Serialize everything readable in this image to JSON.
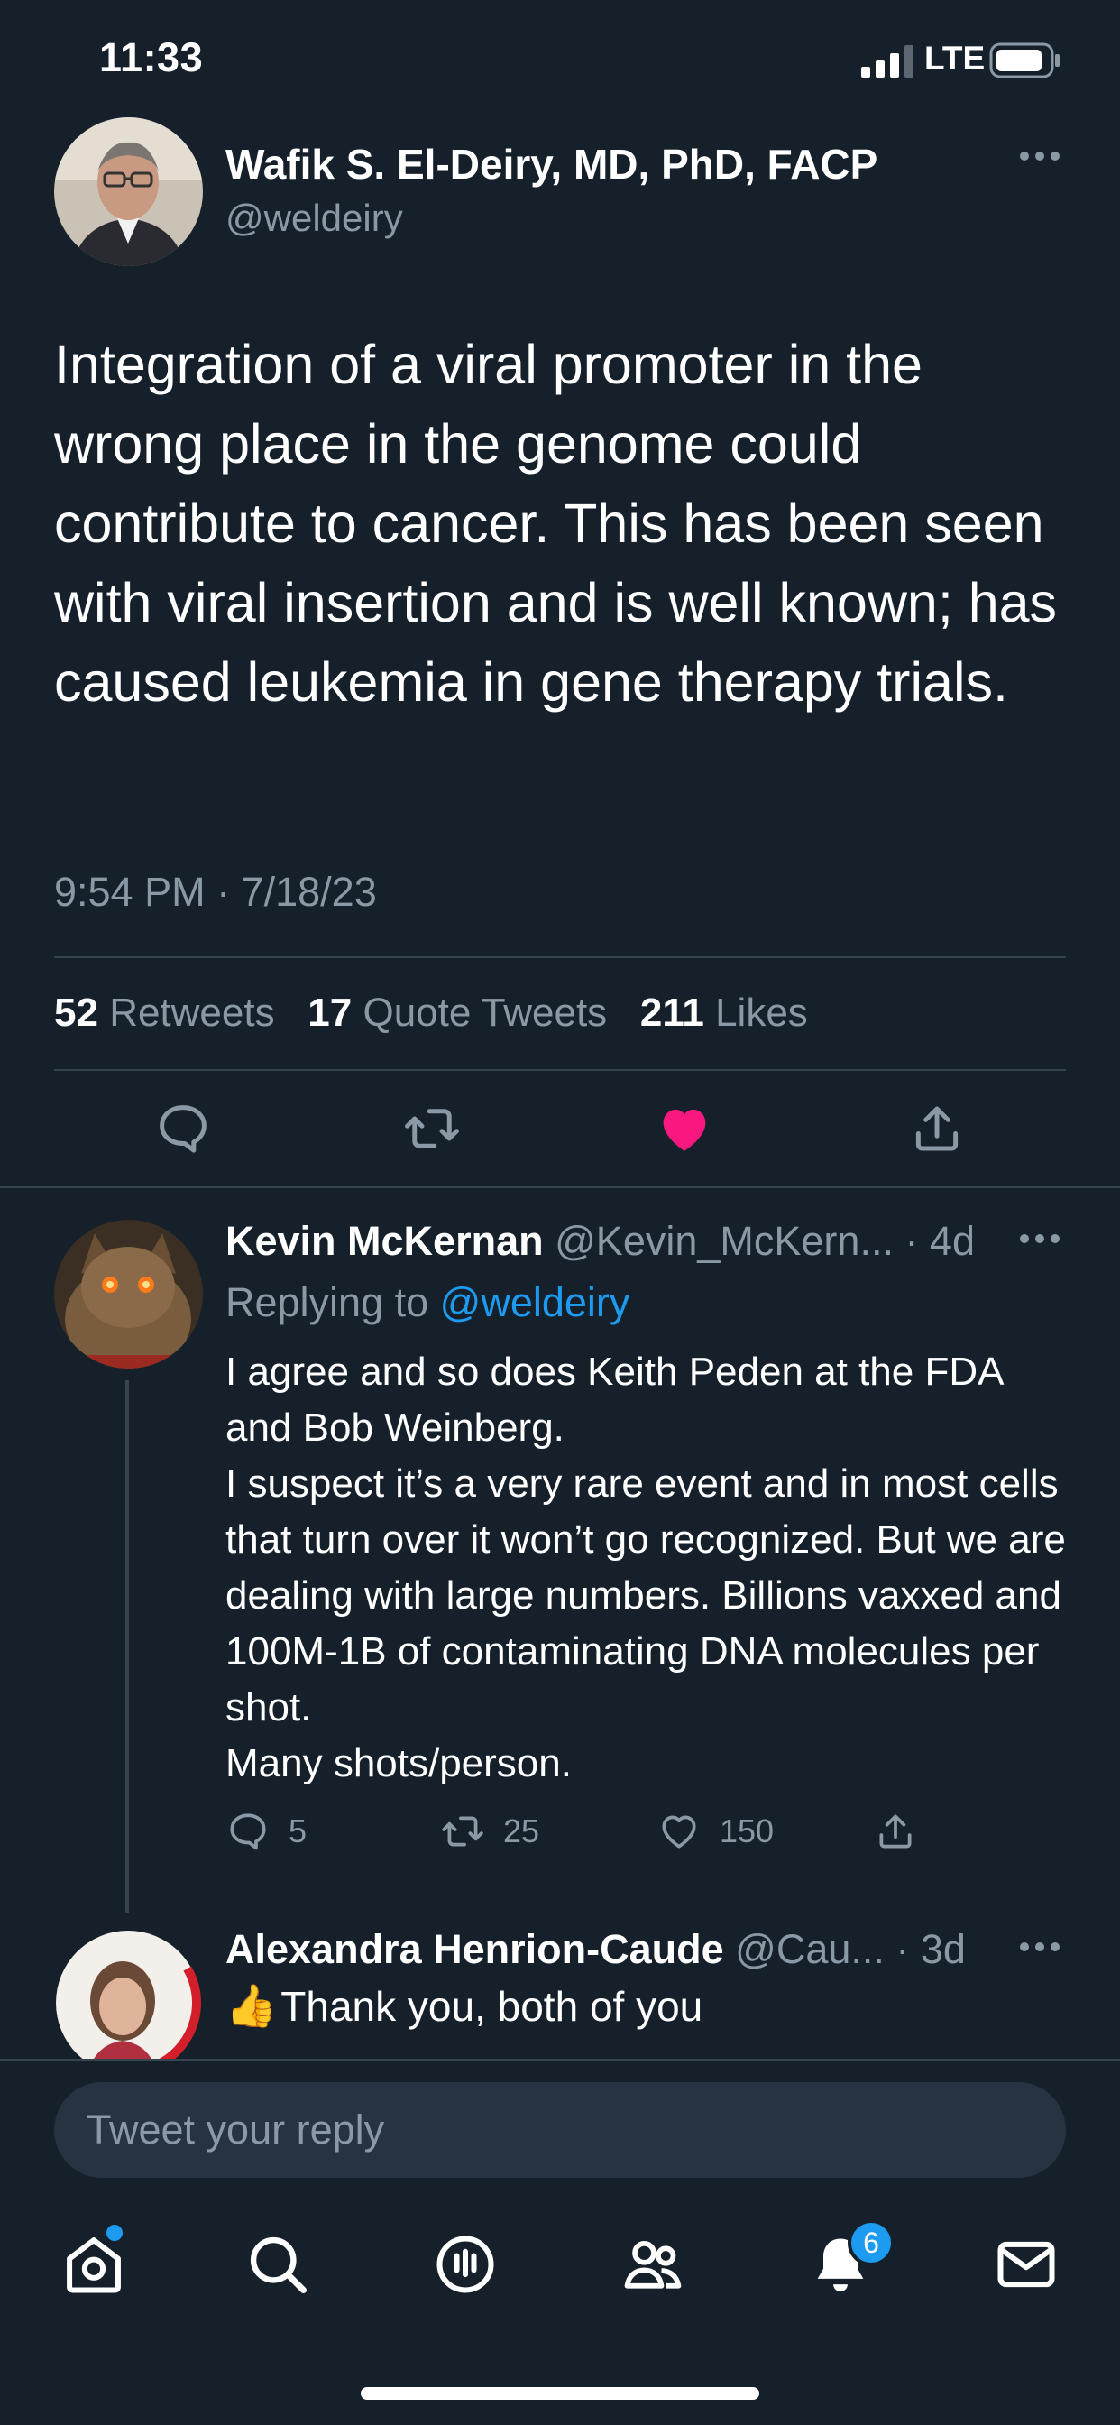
{
  "status_bar": {
    "time": "11:33",
    "network": "LTE"
  },
  "tweet": {
    "author_name": "Wafik S. El-Deiry, MD, PhD, FACP",
    "author_handle": "@weldeiry",
    "text": "Integration of a viral promoter in the wrong place in the genome could contribute to cancer. This has been seen with viral insertion and is well known; has caused leukemia in gene therapy trials.",
    "timestamp": "9:54 PM · 7/18/23",
    "stats": {
      "retweets_count": "52",
      "retweets_label": "Retweets",
      "quotes_count": "17",
      "quotes_label": "Quote Tweets",
      "likes_count": "211",
      "likes_label": "Likes"
    },
    "liked": true,
    "like_color": "#f91880"
  },
  "replies": [
    {
      "name": "Kevin McKernan",
      "handle_time": "@Kevin_McKern... · 4d",
      "replying_prefix": "Replying to",
      "replying_handle": "@weldeiry",
      "text": "I agree and so does Keith Peden at the FDA and Bob Weinberg.\nI suspect it’s a very rare event and in most cells that turn over it won’t go recognized. But we are dealing with large numbers. Billions vaxxed and 100M-1B of contaminating DNA molecules per shot.\nMany shots/person.",
      "reply_count": "5",
      "retweet_count": "25",
      "like_count": "150"
    },
    {
      "name": "Alexandra Henrion-Caude",
      "handle_time": "@Cau... · 3d",
      "emoji": "👍",
      "text": "Thank you, both of you"
    }
  ],
  "composer": {
    "placeholder": "Tweet your reply"
  },
  "nav": {
    "notification_count": "6"
  },
  "colors": {
    "background": "#15202b",
    "accent": "#1d9bf0",
    "muted": "#8b98a5",
    "like": "#f91880"
  }
}
